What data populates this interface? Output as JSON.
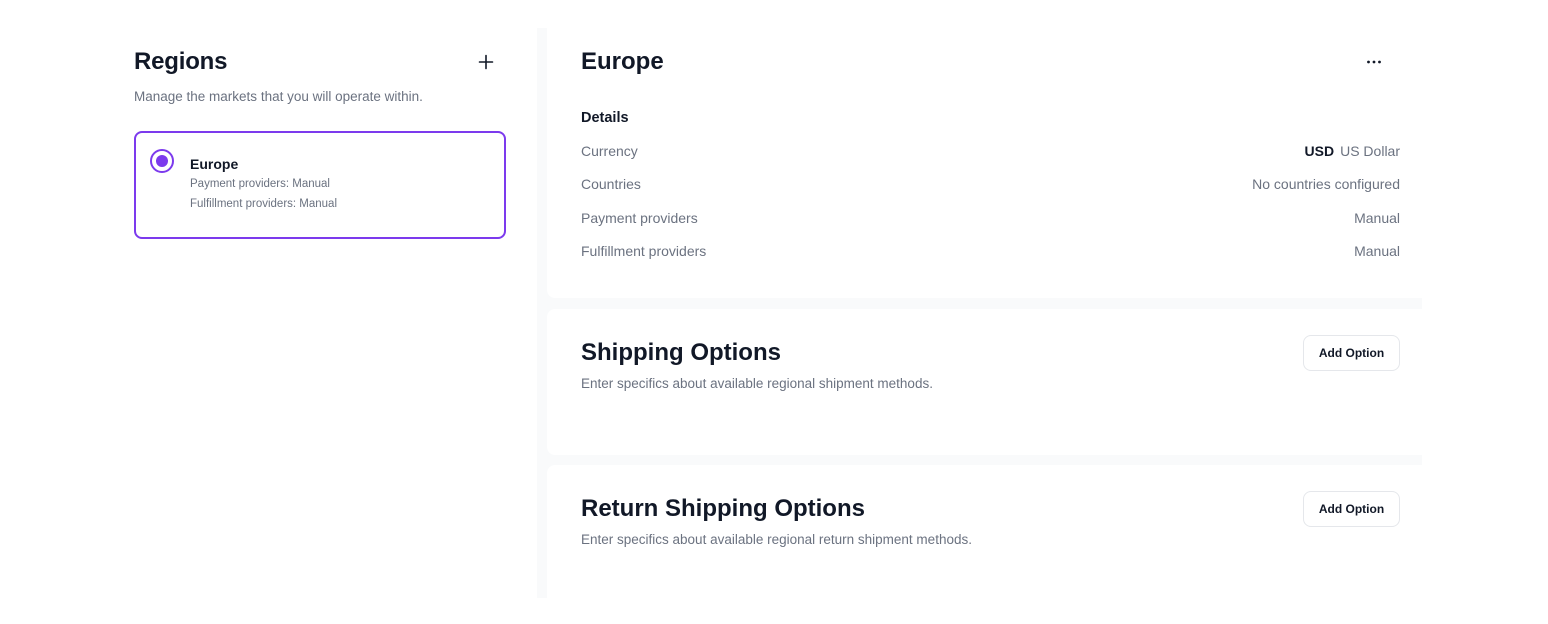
{
  "regions_panel": {
    "title": "Regions",
    "add_icon": "plus-icon",
    "subtitle": "Manage the markets that you will operate within.",
    "items": [
      {
        "name": "Europe",
        "selected": true,
        "payment_providers": "Payment providers: Manual",
        "fulfillment_providers": "Fulfillment providers: Manual"
      }
    ]
  },
  "region_detail": {
    "title": "Europe",
    "more_icon": "more-horizontal-icon",
    "details_heading": "Details",
    "rows": [
      {
        "label": "Currency",
        "code": "USD",
        "value": "US Dollar"
      },
      {
        "label": "Countries",
        "value": "No countries configured"
      },
      {
        "label": "Payment providers",
        "value": "Manual"
      },
      {
        "label": "Fulfillment providers",
        "value": "Manual"
      }
    ]
  },
  "shipping_options": {
    "title": "Shipping Options",
    "subtitle": "Enter specifics about available regional shipment methods.",
    "button_label": "Add Option"
  },
  "return_shipping_options": {
    "title": "Return Shipping Options",
    "subtitle": "Enter specifics about available regional return shipment methods.",
    "button_label": "Add Option"
  },
  "colors": {
    "accent": "#7c3aed",
    "text_primary": "#111827",
    "text_secondary": "#6b7280",
    "panel_bg": "#f9fafb",
    "border": "#e5e7eb"
  }
}
